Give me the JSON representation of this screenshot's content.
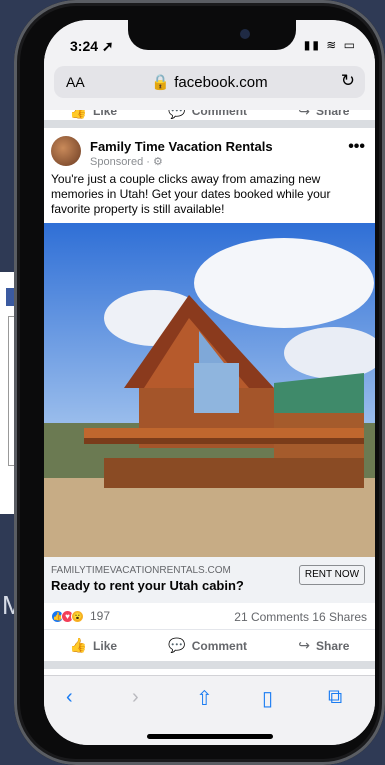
{
  "status_bar": {
    "time": "3:24 ➚",
    "icons": "▮▮ ≋ ▭"
  },
  "browser": {
    "aa_label": "AA",
    "url": "🔒 facebook.com",
    "reload_icon": "↻"
  },
  "top_actions": {
    "like": "Like",
    "comment": "Comment",
    "share": "Share"
  },
  "post": {
    "page_name": "Family Time Vacation Rentals",
    "sponsored": "Sponsored · ⚙",
    "more_icon": "•••",
    "text": "You're just a couple clicks away from amazing new memories in Utah! Get your dates booked while your favorite property is still available!",
    "link_domain": "FAMILYTIMEVACATIONRENTALS.COM",
    "link_title": "Ready to rent your Utah cabin?",
    "cta": "RENT NOW",
    "reaction_count": "197",
    "comments_shares": "21 Comments  16 Shares"
  },
  "bottom_actions": {
    "like": "Like",
    "comment": "Comment",
    "share": "Share"
  },
  "background": {
    "partial_text": "Ma"
  },
  "colors": {
    "accent": "#1a7cf2",
    "facebook_blue": "#1877f2",
    "phone_bg": "#2f3a55"
  }
}
